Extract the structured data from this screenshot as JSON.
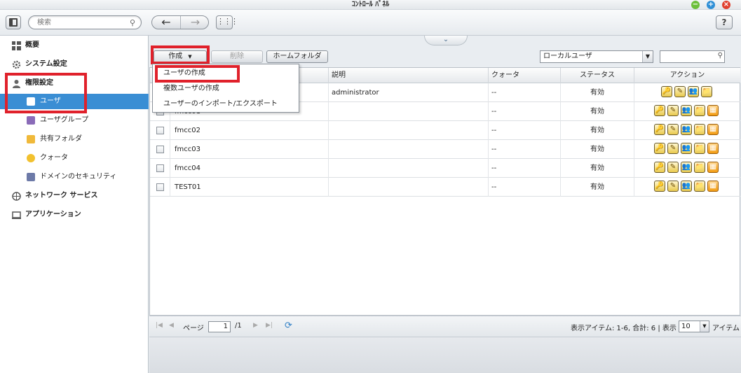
{
  "window": {
    "title": "ｺﾝﾄﾛｰﾙ ﾊﾟﾈﾙ"
  },
  "toolbar": {
    "search_placeholder": "検索",
    "back_icon": "←",
    "forward_icon": "→",
    "apps_icon": "⋯",
    "help_label": "?"
  },
  "sidebar": {
    "items": [
      {
        "label": "概要",
        "icon": "overview-icon"
      },
      {
        "label": "システム設定",
        "icon": "gear-icon"
      },
      {
        "label": "権限設定",
        "icon": "user-icon"
      },
      {
        "label": "ネットワーク サービス",
        "icon": "network-icon"
      },
      {
        "label": "アプリケーション",
        "icon": "application-icon"
      }
    ],
    "subitems": [
      {
        "label": "ユーザ",
        "icon": "user-icon",
        "active": true
      },
      {
        "label": "ユーザグループ",
        "icon": "user-group-icon"
      },
      {
        "label": "共有フォルダ",
        "icon": "folder-icon"
      },
      {
        "label": "クォータ",
        "icon": "quota-icon"
      },
      {
        "label": "ドメインのセキュリティ",
        "icon": "domain-security-icon"
      }
    ]
  },
  "actions": {
    "create": "作成",
    "delete": "削除",
    "home_folder": "ホームフォルダ",
    "filter_value": "ローカルユーザ"
  },
  "dropdown": {
    "items": [
      "ユーザの作成",
      "複数ユーザの作成",
      "ユーザーのインポート/エクスポート"
    ]
  },
  "table": {
    "headers": {
      "description": "説明",
      "quota": "クォータ",
      "status": "ステータス",
      "action": "アクション"
    },
    "rows": [
      {
        "name": "",
        "description": "administrator",
        "quota": "--",
        "status": "有効",
        "actions": 4
      },
      {
        "name": "fmcc01",
        "description": "",
        "quota": "--",
        "status": "有効",
        "actions": 5
      },
      {
        "name": "fmcc02",
        "description": "",
        "quota": "--",
        "status": "有効",
        "actions": 5
      },
      {
        "name": "fmcc03",
        "description": "",
        "quota": "--",
        "status": "有効",
        "actions": 5
      },
      {
        "name": "fmcc04",
        "description": "",
        "quota": "--",
        "status": "有効",
        "actions": 5
      },
      {
        "name": "TEST01",
        "description": "",
        "quota": "--",
        "status": "有効",
        "actions": 5
      }
    ]
  },
  "pager": {
    "page_label": "ページ",
    "page_value": "1",
    "page_total": "/1",
    "summary": "表示アイテム: 1-6, 合計: 6 | 表示",
    "per_page": "10",
    "items_label": "アイテム"
  },
  "colors": {
    "accent": "#3a8ed4",
    "highlight": "#e0212b"
  }
}
